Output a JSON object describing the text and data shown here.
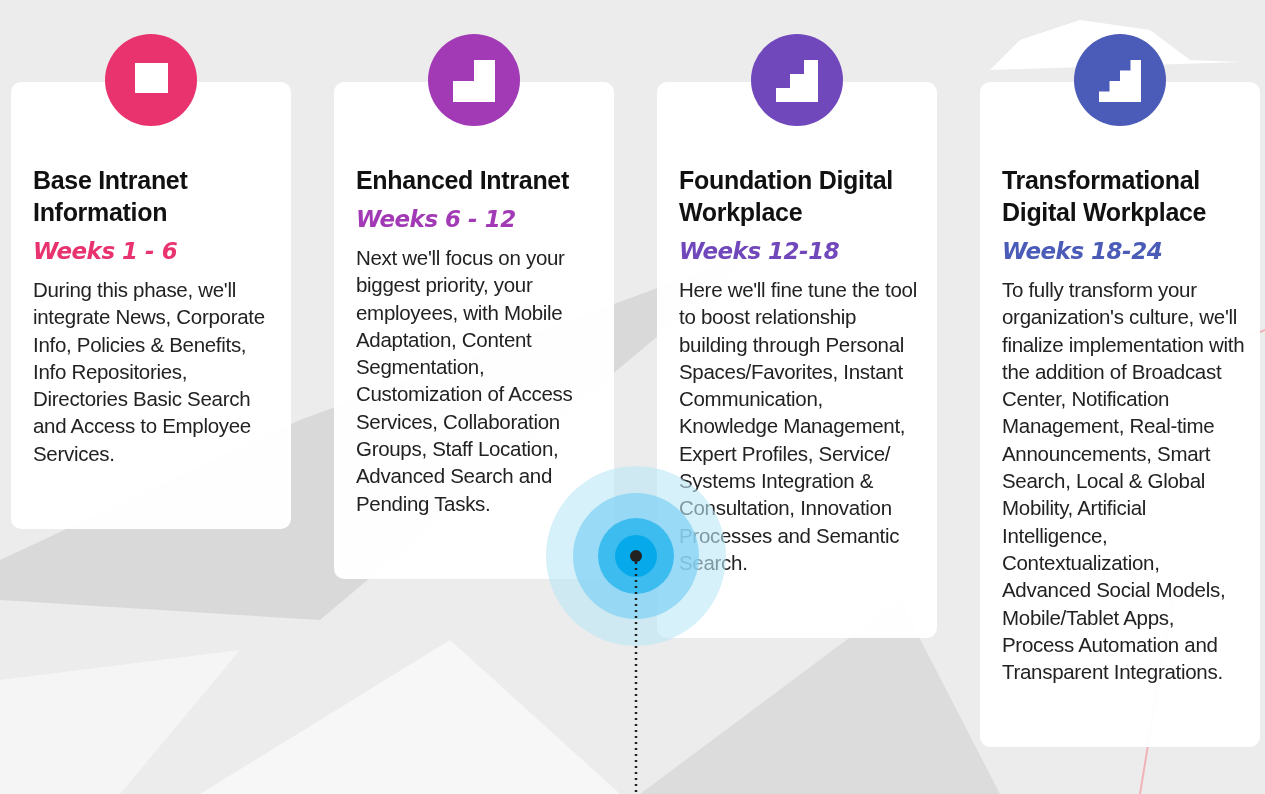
{
  "phases": [
    {
      "title": "Base Intranet Information",
      "weeks": "Weeks 1 - 6",
      "color": "#e8336f",
      "description": "During this phase, we'll integrate News, Corporate Info, Policies & Benefits, Info Repositories, Directories Basic Search and Access to Employee Services."
    },
    {
      "title": "Enhanced Intranet",
      "weeks": "Weeks 6 - 12",
      "color": "#a23ab6",
      "description": "Next we'll focus on your biggest priority, your employees, with Mobile Adaptation, Content Segmentation, Customization of Access Services, Collaboration Groups, Staff Location, Advanced Search and Pending Tasks."
    },
    {
      "title": "Foundation Digital Workplace",
      "weeks": "Weeks 12-18",
      "color": "#7148bb",
      "description": "Here we'll fine tune the tool to boost relationship building through Personal Spaces/Favorites, Instant Communication, Knowledge Management, Expert Profiles, Service/ Systems Integration & Consultation, Innovation Processes and Semantic Search."
    },
    {
      "title": "Transformational Digital Workplace",
      "weeks": "Weeks 18-24",
      "color": "#4b5bb8",
      "description": "To fully transform your organization's culture, we'll finalize implementation with the addition of Broadcast Center, Notification Management, Real-time Announcements, Smart Search, Local & Global Mobility, Artificial Intelligence, Contextualization, Advanced Social Models, Mobile/Tablet Apps, Process Automation and Transparent Integrations."
    }
  ]
}
